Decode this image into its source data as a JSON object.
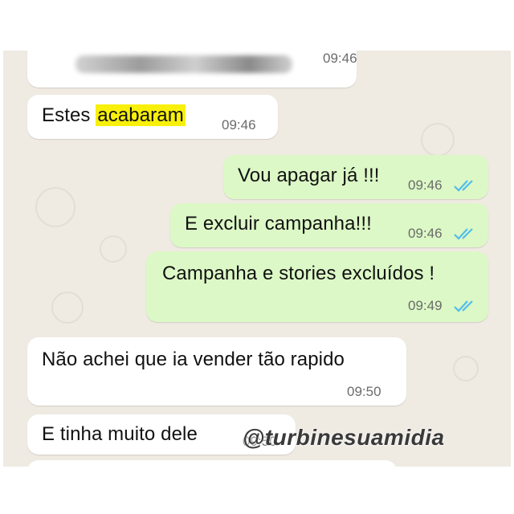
{
  "chat": {
    "messages": [
      {
        "text": "",
        "time": "09:46",
        "direction": "incoming",
        "obscured": true
      },
      {
        "text_before": "Estes ",
        "highlight": "acabaram",
        "time": "09:46",
        "direction": "incoming"
      },
      {
        "text": "Vou apagar já !!!",
        "time": "09:46",
        "direction": "outgoing",
        "status": "read"
      },
      {
        "text": "E excluir campanha!!!",
        "time": "09:46",
        "direction": "outgoing",
        "status": "read"
      },
      {
        "text": "Campanha e stories excluídos !",
        "time": "09:49",
        "direction": "outgoing",
        "status": "read"
      },
      {
        "text": "Não achei que ia vender tão rapido",
        "time": "09:50",
        "direction": "incoming"
      },
      {
        "text": "E tinha muito dele",
        "time": "09:50",
        "direction": "incoming"
      }
    ]
  },
  "watermark": "@turbinesuamidia",
  "colors": {
    "chat_background": "#efeae2",
    "incoming_bubble": "#ffffff",
    "outgoing_bubble": "#dcf8c6",
    "highlight": "#f8f00a",
    "read_ticks": "#53bdeb"
  },
  "icons": {
    "read_receipt": "double-check-icon"
  }
}
